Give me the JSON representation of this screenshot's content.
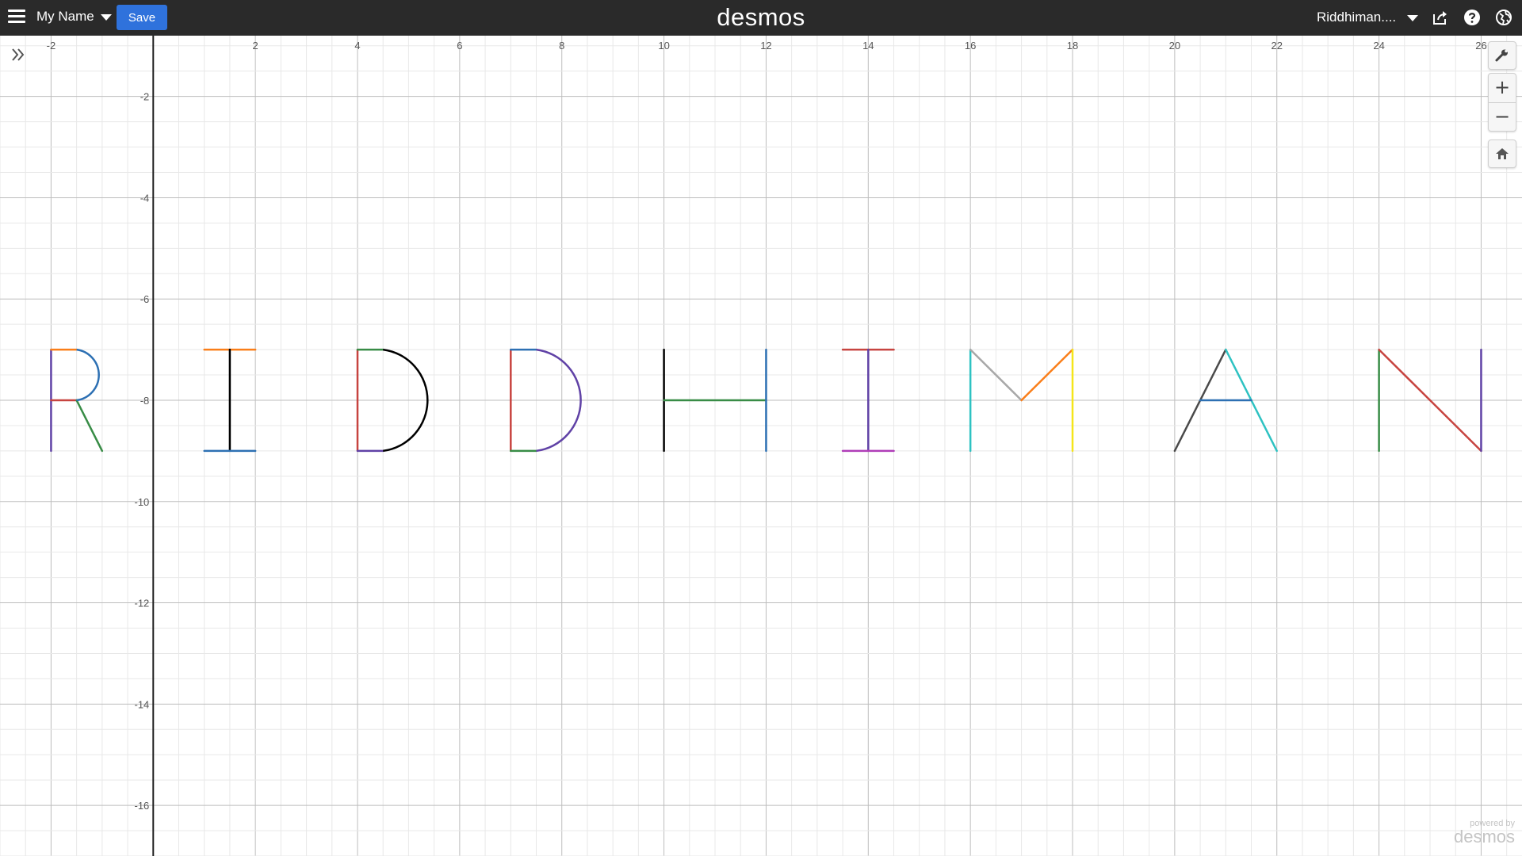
{
  "header": {
    "graph_title": "My Name",
    "save_label": "Save",
    "brand": "desmos",
    "user_name": "Riddhiman...."
  },
  "watermark": {
    "line1": "powered by",
    "line2": "desmos"
  },
  "colors": {
    "topbar": "#2a2a2a",
    "save": "#2f72dc",
    "red": "#c74440",
    "blue": "#2d70b3",
    "green": "#388c46",
    "purple": "#6042a6",
    "orange": "#fa7e19",
    "black": "#000000",
    "magenta": "#b03eb8",
    "cyan": "#2ec2c2",
    "gray": "#a8a8a8",
    "yellow": "#f5e51a",
    "darkgray": "#4a4a4a"
  },
  "viewport": {
    "xmin": -3,
    "xmax": 26.8,
    "ymin": -17,
    "ymax": -0.8
  },
  "axes": {
    "x_ticks": [
      -2,
      2,
      4,
      6,
      8,
      10,
      12,
      14,
      16,
      18,
      20,
      22,
      24,
      26
    ],
    "y_ticks": [
      -2,
      -4,
      -6,
      -8,
      -10,
      -12,
      -14,
      -16
    ]
  },
  "icons": [
    "hamburger-icon",
    "share-icon",
    "help-icon",
    "language-icon",
    "expand-icon",
    "wrench-icon",
    "plus-icon",
    "minus-icon",
    "home-icon"
  ],
  "chart_data": {
    "type": "line",
    "segments": [
      {
        "c": "#6042a6",
        "x": [
          -2,
          -2
        ],
        "y": [
          -7,
          -9
        ]
      },
      {
        "c": "#fa7e19",
        "x": [
          -2,
          -1.5
        ],
        "y": [
          -7,
          -7
        ]
      },
      {
        "c": "#c74440",
        "x": [
          -2,
          -1.5
        ],
        "y": [
          -8,
          -8
        ]
      },
      {
        "c": "#388c46",
        "x": [
          -1.5,
          -1
        ],
        "y": [
          -8,
          -9
        ]
      },
      {
        "c": "#fa7e19",
        "x": [
          1,
          2
        ],
        "y": [
          -7,
          -7
        ]
      },
      {
        "c": "#000000",
        "x": [
          1.5,
          1.5
        ],
        "y": [
          -7,
          -9
        ]
      },
      {
        "c": "#2d70b3",
        "x": [
          1,
          2
        ],
        "y": [
          -9,
          -9
        ]
      },
      {
        "c": "#c74440",
        "x": [
          4,
          4
        ],
        "y": [
          -7,
          -9
        ]
      },
      {
        "c": "#388c46",
        "x": [
          4,
          4.5
        ],
        "y": [
          -7,
          -7
        ]
      },
      {
        "c": "#6042a6",
        "x": [
          4,
          4.5
        ],
        "y": [
          -9,
          -9
        ]
      },
      {
        "c": "#c74440",
        "x": [
          7,
          7
        ],
        "y": [
          -7,
          -9
        ]
      },
      {
        "c": "#2d70b3",
        "x": [
          7,
          7.5
        ],
        "y": [
          -7,
          -7
        ]
      },
      {
        "c": "#388c46",
        "x": [
          7,
          7.5
        ],
        "y": [
          -9,
          -9
        ]
      },
      {
        "c": "#000000",
        "x": [
          10,
          10
        ],
        "y": [
          -7,
          -9
        ]
      },
      {
        "c": "#388c46",
        "x": [
          10,
          12
        ],
        "y": [
          -8,
          -8
        ]
      },
      {
        "c": "#2d70b3",
        "x": [
          12,
          12
        ],
        "y": [
          -7,
          -9
        ]
      },
      {
        "c": "#c74440",
        "x": [
          13.5,
          14.5
        ],
        "y": [
          -7,
          -7
        ]
      },
      {
        "c": "#6042a6",
        "x": [
          14,
          14
        ],
        "y": [
          -7,
          -9
        ]
      },
      {
        "c": "#b03eb8",
        "x": [
          13.5,
          14.5
        ],
        "y": [
          -9,
          -9
        ]
      },
      {
        "c": "#2ec2c2",
        "x": [
          16,
          16
        ],
        "y": [
          -7,
          -9
        ]
      },
      {
        "c": "#a8a8a8",
        "x": [
          16,
          17
        ],
        "y": [
          -7,
          -8
        ]
      },
      {
        "c": "#fa7e19",
        "x": [
          17,
          18
        ],
        "y": [
          -8,
          -7
        ]
      },
      {
        "c": "#f5e51a",
        "x": [
          18,
          18
        ],
        "y": [
          -7,
          -9
        ]
      },
      {
        "c": "#4a4a4a",
        "x": [
          20,
          21
        ],
        "y": [
          -9,
          -7
        ]
      },
      {
        "c": "#2ec2c2",
        "x": [
          21,
          22
        ],
        "y": [
          -7,
          -9
        ]
      },
      {
        "c": "#2d70b3",
        "x": [
          20.5,
          21.5
        ],
        "y": [
          -8,
          -8
        ]
      },
      {
        "c": "#388c46",
        "x": [
          24,
          24
        ],
        "y": [
          -7,
          -9
        ]
      },
      {
        "c": "#c74440",
        "x": [
          24,
          26
        ],
        "y": [
          -7,
          -9
        ]
      },
      {
        "c": "#6042a6",
        "x": [
          26,
          26
        ],
        "y": [
          -7,
          -9
        ]
      }
    ],
    "arcs": [
      {
        "c": "#2d70b3",
        "cx": -1.5,
        "cy": -7.5,
        "r": 0.5
      },
      {
        "c": "#000000",
        "cx": 4.5,
        "cy": -8,
        "r": 1
      },
      {
        "c": "#6042a6",
        "cx": 7.5,
        "cy": -8,
        "r": 1
      }
    ]
  }
}
